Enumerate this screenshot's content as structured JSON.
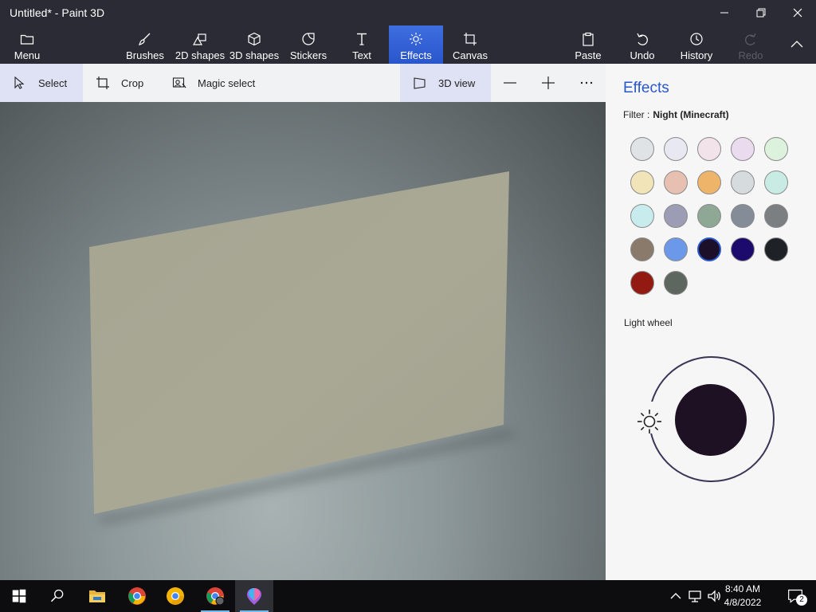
{
  "window": {
    "title": "Untitled* - Paint 3D"
  },
  "ribbon": {
    "menu": "Menu",
    "brushes": "Brushes",
    "shapes2d": "2D shapes",
    "shapes3d": "3D shapes",
    "stickers": "Stickers",
    "text": "Text",
    "effects": "Effects",
    "canvas": "Canvas",
    "paste": "Paste",
    "undo": "Undo",
    "history": "History",
    "redo": "Redo"
  },
  "toolbar": {
    "select": "Select",
    "crop": "Crop",
    "magic_select": "Magic select",
    "view3d": "3D view"
  },
  "panel": {
    "title": "Effects",
    "filter_label": "Filter :",
    "filter_value": "Night (Minecraft)",
    "light_wheel": "Light wheel",
    "swatches": [
      "#dfe3e6",
      "#e8e8f2",
      "#f2e2ea",
      "#eadcee",
      "#dcf2dc",
      "#f1e4b8",
      "#e8c0b2",
      "#edb46a",
      "#d6dbde",
      "#c8ece4",
      "#c8ecee",
      "#9c9cb4",
      "#8fa896",
      "#848c98",
      "#7c7f82",
      "#8a7a6c",
      "#6c98ea",
      "#1b0f2a",
      "#1c0a6c",
      "#1e2226",
      "#921a12",
      "#5e6660"
    ],
    "selected_swatch_index": 17,
    "light_color": "#1e1124"
  },
  "colors": {
    "accent": "#2a56cc",
    "ribbon_bg": "#2b2b35"
  },
  "taskbar": {
    "time": "8:40 AM",
    "date": "4/8/2022",
    "notifications": "2"
  }
}
